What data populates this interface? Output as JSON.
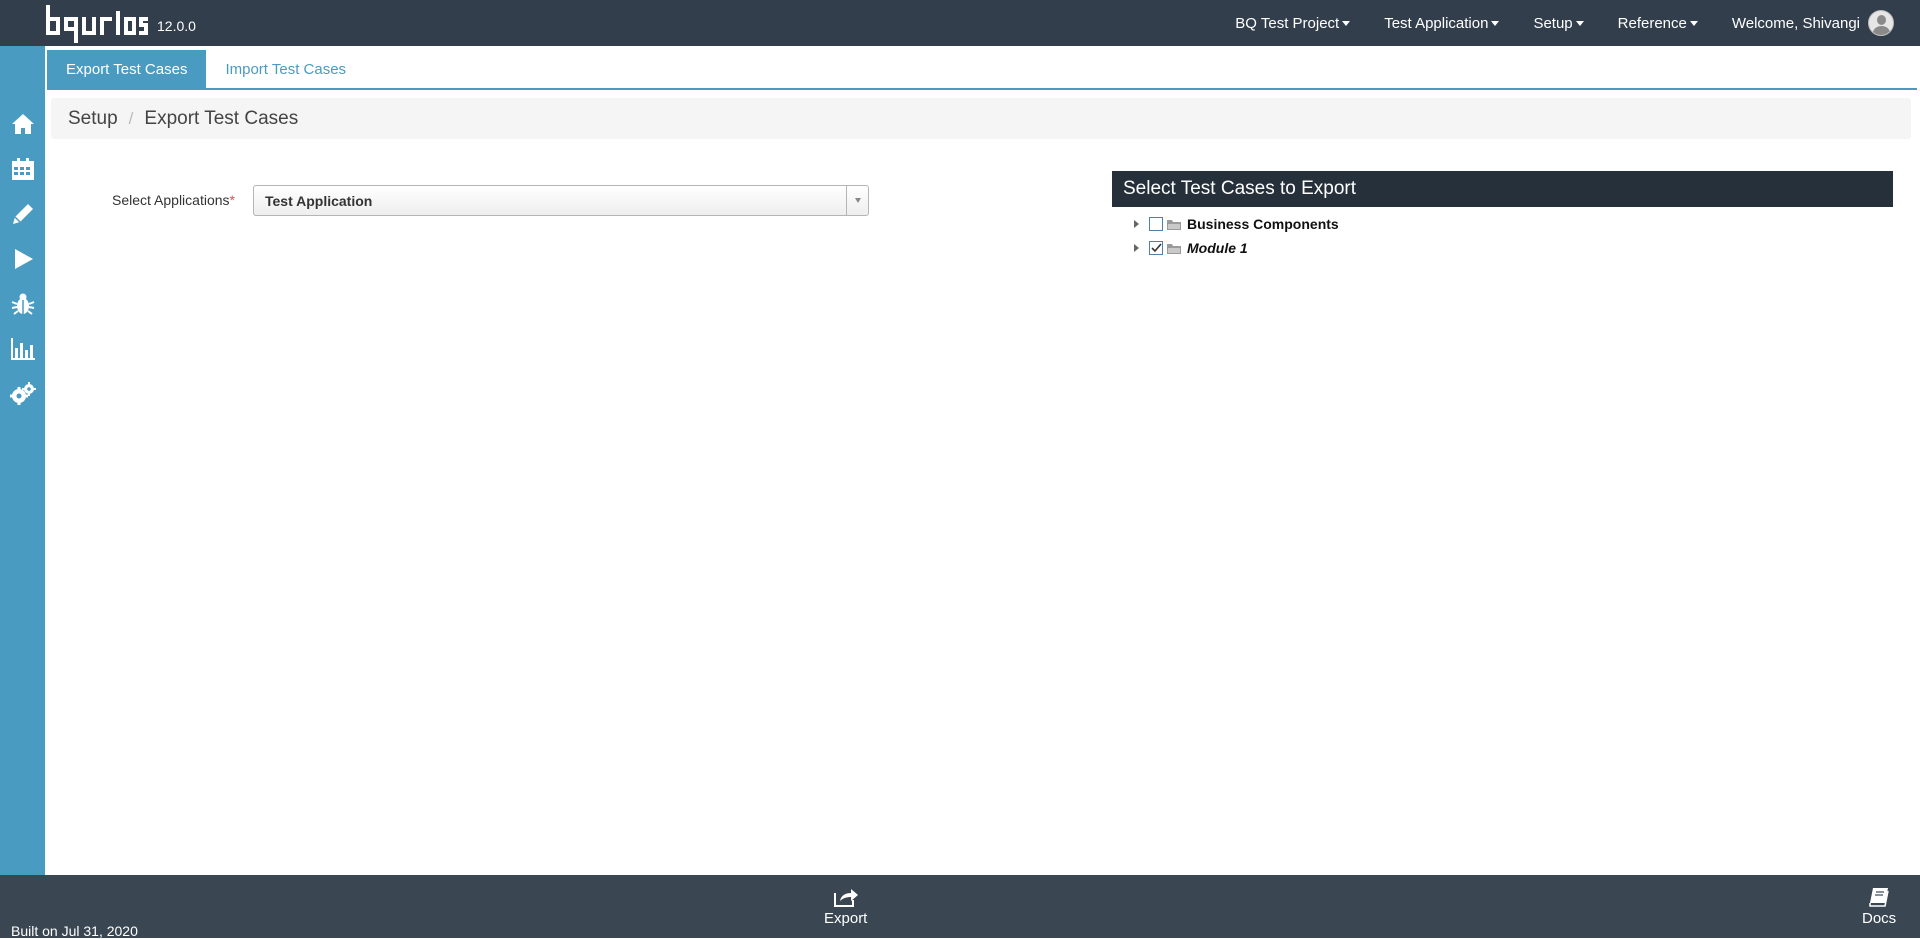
{
  "app": {
    "logo_text": "bqurious",
    "version": "12.0.0"
  },
  "topnav": {
    "project": "BQ Test Project",
    "application": "Test Application",
    "setup": "Setup",
    "reference": "Reference",
    "welcome": "Welcome, Shivangi"
  },
  "sidebar": {
    "items": [
      {
        "icon": "home-icon"
      },
      {
        "icon": "calendar-icon"
      },
      {
        "icon": "pencil-icon"
      },
      {
        "icon": "play-icon"
      },
      {
        "icon": "bug-icon"
      },
      {
        "icon": "bar-chart-icon"
      },
      {
        "icon": "gears-icon"
      }
    ]
  },
  "tabs": [
    {
      "label": "Export Test Cases",
      "active": true
    },
    {
      "label": "Import Test Cases",
      "active": false
    }
  ],
  "breadcrumb": {
    "parent": "Setup",
    "separator": "/",
    "current": "Export Test Cases"
  },
  "form": {
    "select_label": "Select Applications",
    "required_mark": "*",
    "select_value": "Test Application"
  },
  "tree": {
    "header": "Select Test Cases to Export",
    "nodes": [
      {
        "label": "Business Components",
        "checked": false,
        "italic": false
      },
      {
        "label": "Module 1",
        "checked": true,
        "italic": true
      }
    ]
  },
  "footer": {
    "built": "Built on Jul 31, 2020",
    "export_label": "Export",
    "docs_label": "Docs"
  },
  "colors": {
    "topbar": "#323e4b",
    "sidebar": "#4a9bc2",
    "accent": "#4a9bc2",
    "tree_header": "#25303b",
    "footer": "#3a4753"
  }
}
